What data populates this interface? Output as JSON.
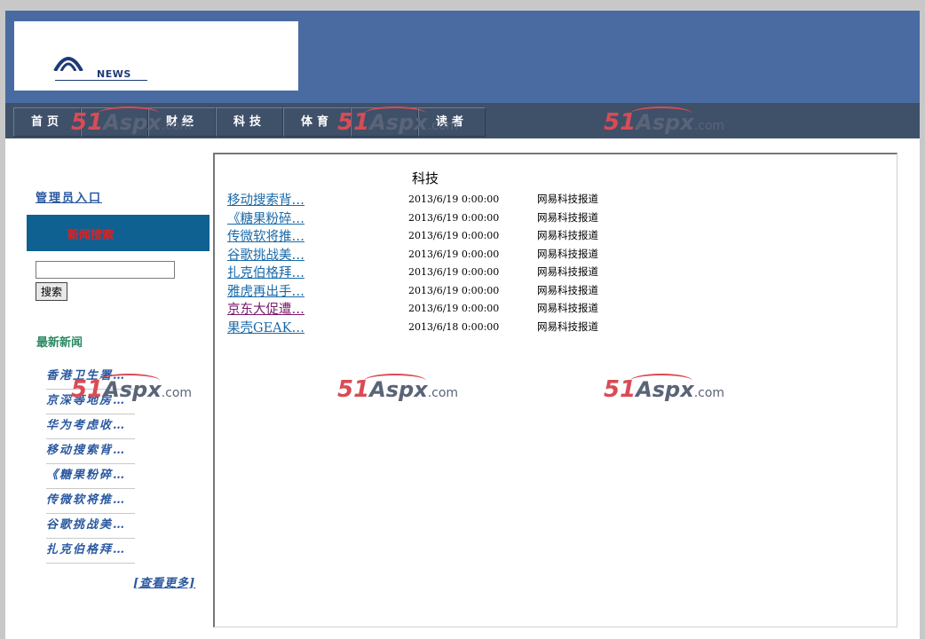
{
  "header": {
    "logo_text": "NEWS"
  },
  "nav": {
    "items": [
      "首页",
      "",
      "财经",
      "科技",
      "体育",
      "",
      "读者"
    ]
  },
  "watermark": {
    "prefix": "51",
    "middle": "Aspx",
    "suffix": ".com"
  },
  "sidebar": {
    "admin_link": "管理员入口",
    "search_title": "新闻搜索",
    "search_value": "",
    "search_button": "搜索",
    "latest_title": "最新新闻",
    "latest_items": [
      "香港卫生署…",
      "京深等地房…",
      "华为考虑收…",
      "移动搜索背…",
      "《糖果粉碎…",
      "传微软将推…",
      "谷歌挑战美…",
      "扎克伯格拜…"
    ],
    "more_link": "[查看更多]"
  },
  "content": {
    "title": "科技",
    "rows": [
      {
        "title": "移动搜索背…",
        "date": "2013/6/19 0:00:00",
        "source": "网易科技报道"
      },
      {
        "title": "《糖果粉碎…",
        "date": "2013/6/19 0:00:00",
        "source": "网易科技报道"
      },
      {
        "title": "传微软将推…",
        "date": "2013/6/19 0:00:00",
        "source": "网易科技报道"
      },
      {
        "title": "谷歌挑战美…",
        "date": "2013/6/19 0:00:00",
        "source": "网易科技报道"
      },
      {
        "title": "扎克伯格拜…",
        "date": "2013/6/19 0:00:00",
        "source": "网易科技报道"
      },
      {
        "title": "雅虎再出手…",
        "date": "2013/6/19 0:00:00",
        "source": "网易科技报道"
      },
      {
        "title": "京东大促遭…",
        "date": "2013/6/19 0:00:00",
        "source": "网易科技报道"
      },
      {
        "title": "果壳GEAK…",
        "date": "2013/6/18 0:00:00",
        "source": "网易科技报道"
      }
    ]
  }
}
